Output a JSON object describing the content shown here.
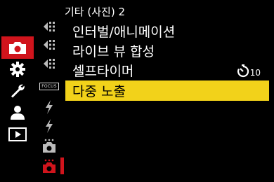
{
  "header": {
    "title": "기타 (사진) 2"
  },
  "main_tabs": [
    {
      "name": "photo",
      "icon": "camera-icon",
      "active": true
    },
    {
      "name": "setup",
      "icon": "gear-icon",
      "active": false
    },
    {
      "name": "custom",
      "icon": "wrench-icon",
      "active": false
    },
    {
      "name": "my-menu",
      "icon": "person-icon",
      "active": false
    },
    {
      "name": "playback",
      "icon": "playback-icon",
      "active": false
    }
  ],
  "sub_tabs": [
    {
      "icon": "quality-icon-1"
    },
    {
      "icon": "quality-icon-2"
    },
    {
      "icon": "quality-icon-3"
    },
    {
      "icon": "focus-icon",
      "label": "FOCUS"
    },
    {
      "icon": "flash-icon-1"
    },
    {
      "icon": "flash-icon-2"
    },
    {
      "icon": "photo-other-1-icon"
    },
    {
      "icon": "photo-other-2-icon",
      "active": true
    }
  ],
  "menu": {
    "items": [
      {
        "label": "인터벌/애니메이션"
      },
      {
        "label": "라이브 뷰 합성"
      },
      {
        "label": "셀프타이머",
        "value_num": "10",
        "value_icon": "self-timer-icon"
      },
      {
        "label": "다중 노출",
        "selected": true
      }
    ]
  },
  "colors": {
    "accent": "#d0141c",
    "highlight": "#f2d21a"
  }
}
